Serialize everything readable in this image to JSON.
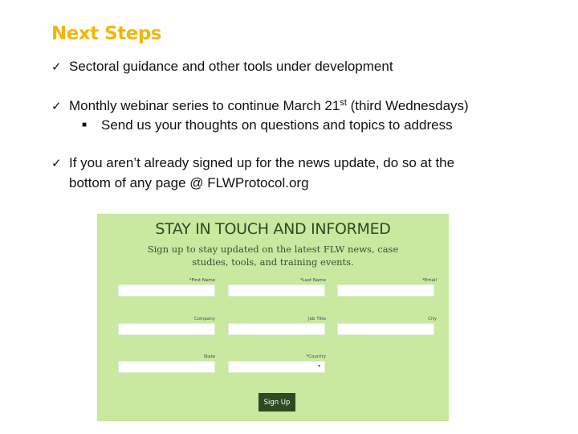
{
  "title": "Next Steps",
  "bullets": [
    {
      "icon": "checkmark-icon",
      "text": "Sectoral guidance and other tools under development"
    },
    {
      "icon": "checkmark-icon",
      "text_before": "Monthly webinar series to continue March 21",
      "superscript": "st",
      "text_after": " (third Wednesdays)",
      "sub_bullets": [
        {
          "icon": "square-bullet-icon",
          "text": "Send us your thoughts on questions and topics to address"
        }
      ]
    },
    {
      "icon": "checkmark-icon",
      "line1": "If you aren’t already signed up for the news update, do so at the",
      "line2": "bottom of any page @ FLWProtocol.org"
    }
  ],
  "glyphs": {
    "check": "✓",
    "square": "■",
    "dropdown": "▼"
  },
  "signup_form": {
    "heading": "STAY IN TOUCH AND INFORMED",
    "subheading": "Sign up to stay updated on the latest FLW news, case studies, tools, and training events.",
    "fields": [
      {
        "label": "*First Name",
        "value": ""
      },
      {
        "label": "*Last Name",
        "value": ""
      },
      {
        "label": "*Email",
        "value": ""
      },
      {
        "label": "Company",
        "value": ""
      },
      {
        "label": "Job Title",
        "value": ""
      },
      {
        "label": "City",
        "value": ""
      },
      {
        "label": "State",
        "value": ""
      },
      {
        "label": "*Country",
        "value": "",
        "type": "select"
      }
    ],
    "submit_label": "Sign Up",
    "colors": {
      "background": "#c9e8a0",
      "button": "#2f4a22",
      "heading": "#2d4a22"
    }
  },
  "colors": {
    "title": "#f2b705"
  }
}
